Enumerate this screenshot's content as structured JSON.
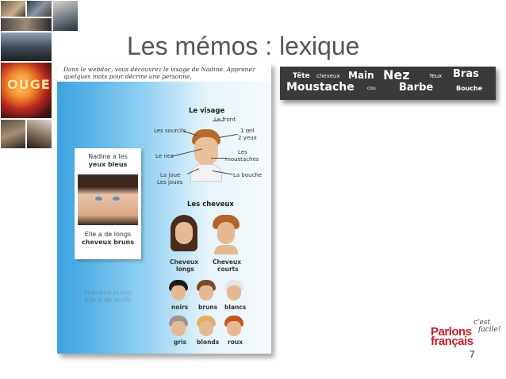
{
  "slide": {
    "title": "Les mémos : lexique",
    "page_number": "7"
  },
  "document": {
    "intro": "Dans le webdoc, vous découvrez le visage de Nadine. Apprenez quelques mots pour décrire une personne.",
    "card_top_line1": "Nadine a les",
    "card_top_line2": "yeux bleus",
    "card_bottom_line1": "Elle a de longs",
    "card_bottom_line2": "cheveux bruns",
    "visage_title": "Le visage",
    "labels": {
      "front": "Le front",
      "sourcils": "Les sourcils",
      "oeil": "1 œil",
      "yeux": "2 yeux",
      "nez": "Le nez",
      "moustaches_1": "Les",
      "moustaches_2": "moustaches",
      "joue": "La joue",
      "joues": "Les joues",
      "bouche": "La bouche"
    },
    "cheveux_title": "Les cheveux",
    "long_1": "Cheveux",
    "long_2": "longs",
    "court_1": "Cheveux",
    "court_2": "courts",
    "colors": [
      "noirs",
      "bruns",
      "blancs",
      "gris",
      "blonds",
      "roux"
    ],
    "hair_colors_hex": [
      "#1e1a18",
      "#7a4a26",
      "#e8e6e2",
      "#9a9590",
      "#e0b060",
      "#c4561e"
    ]
  },
  "banner": {
    "words": [
      "Tête",
      "cheveux",
      "Main",
      "Nez",
      "Yeux",
      "Bras",
      "Moustache",
      "cou",
      "Barbe",
      "Bouche"
    ]
  },
  "collage": {
    "sign_text": "OUGE"
  },
  "logo": {
    "line1": "Parlons",
    "line2": "français",
    "tag1": "c'est",
    "tag2": "facile!"
  }
}
